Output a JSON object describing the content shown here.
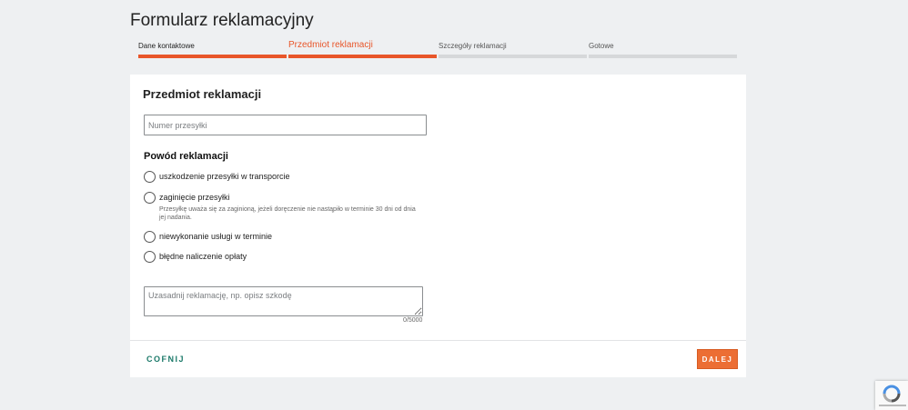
{
  "page": {
    "title": "Formularz reklamacyjny"
  },
  "steps": [
    {
      "label": "Dane kontaktowe",
      "state": "done"
    },
    {
      "label": "Przedmiot reklamacji",
      "state": "active"
    },
    {
      "label": "Szczegóły reklamacji",
      "state": "pending"
    },
    {
      "label": "Gotowe",
      "state": "pending"
    }
  ],
  "form": {
    "section_title": "Przedmiot reklamacji",
    "shipment_number": {
      "placeholder": "Numer przesyłki",
      "value": ""
    },
    "reason_heading": "Powód reklamacji",
    "reasons": [
      {
        "label": "uszkodzenie przesyłki w transporcie",
        "help": "",
        "checked": false
      },
      {
        "label": "zaginięcie przesyłki",
        "help": "Przesyłkę uważa się za zaginioną, jeżeli doręczenie nie nastąpiło w terminie 30 dni od dnia jej nadania.",
        "checked": false
      },
      {
        "label": "niewykonanie usługi w terminie",
        "help": "",
        "checked": false
      },
      {
        "label": "błędne naliczenie opłaty",
        "help": "",
        "checked": false
      }
    ],
    "justification": {
      "placeholder": "Uzasadnij reklamację, np. opisz szkodę",
      "value": ""
    },
    "counter": "0/5000"
  },
  "actions": {
    "back_label": "COFNIJ",
    "next_label": "DALEJ"
  },
  "colors": {
    "accent": "#e8562a",
    "button": "#ec6e34",
    "link": "#1c7a6a",
    "background": "#eef0f2"
  }
}
